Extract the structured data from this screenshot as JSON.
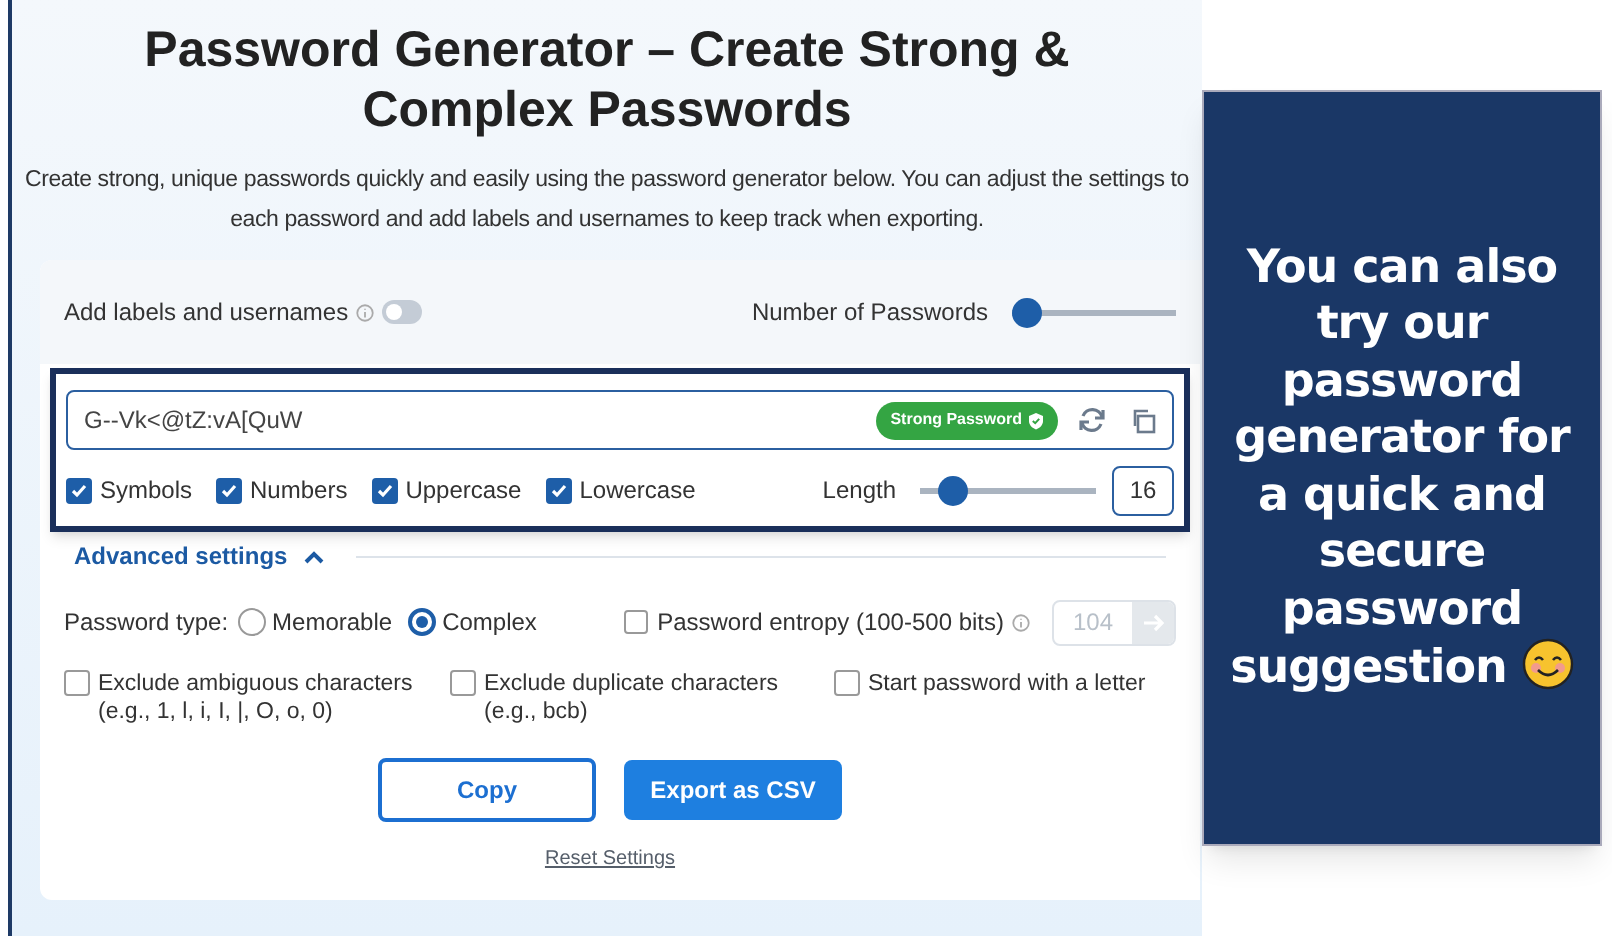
{
  "title": "Password Generator – Create Strong & Complex Passwords",
  "description": [
    "Create strong, unique passwords quickly and easily using the password generator below. You can adjust the settings to",
    "each password and add labels and usernames to keep track when exporting."
  ],
  "labels_toggle": {
    "label": "Add labels and usernames",
    "on": false
  },
  "number_of_passwords": {
    "label": "Number of Passwords",
    "level": 0.0
  },
  "password": {
    "value": "G--Vk<@tZ:vA[QuW",
    "badge": "Strong Password"
  },
  "char_options": [
    {
      "label": "Symbols",
      "checked": true
    },
    {
      "label": "Numbers",
      "checked": true
    },
    {
      "label": "Uppercase",
      "checked": true
    },
    {
      "label": "Lowercase",
      "checked": true
    }
  ],
  "length": {
    "label": "Length",
    "level": 0.12,
    "value": "16"
  },
  "advanced": {
    "label": "Advanced settings",
    "expanded": true
  },
  "password_type": {
    "label": "Password type:",
    "options": [
      {
        "label": "Memorable",
        "selected": false
      },
      {
        "label": "Complex",
        "selected": true
      }
    ]
  },
  "entropy": {
    "label": "Password entropy (100-500 bits)",
    "checked": false,
    "placeholder": "104"
  },
  "exclude_options": [
    {
      "label": "Exclude ambiguous characters",
      "hint": "(e.g., 1, l, i, I, |, O, o, 0)",
      "checked": false
    },
    {
      "label": "Exclude duplicate characters",
      "hint": "(e.g., bcb)",
      "checked": false
    },
    {
      "label": "Start password with a letter",
      "checked": false
    }
  ],
  "buttons": [
    {
      "label": "Copy",
      "kind": "outline"
    },
    {
      "label": "Export as CSV",
      "kind": "primary"
    }
  ],
  "reset_link": "Reset Settings",
  "callout": {
    "text": "You can also try our password generator for a quick and secure password suggestion"
  }
}
